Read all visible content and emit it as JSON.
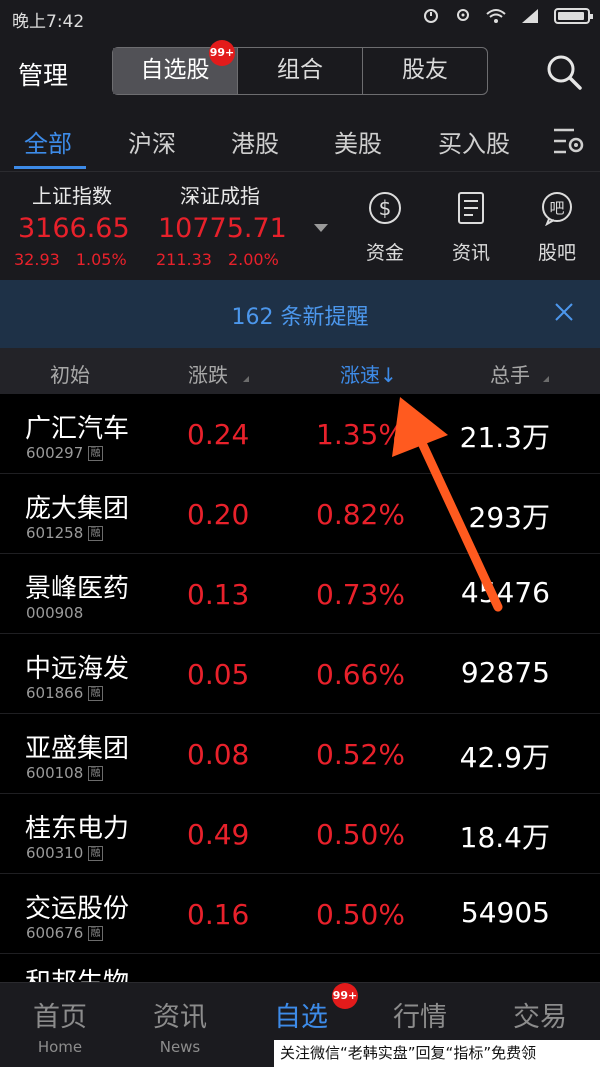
{
  "status": {
    "time": "晚上7:42"
  },
  "header": {
    "manage": "管理",
    "segments": [
      "自选股",
      "组合",
      "股友"
    ],
    "badge": "99+"
  },
  "tabs": [
    "全部",
    "沪深",
    "港股",
    "美股",
    "买入股"
  ],
  "indices": [
    {
      "name": "上证指数",
      "value": "3166.65",
      "change": "32.93",
      "percent": "1.05%"
    },
    {
      "name": "深证成指",
      "value": "10775.71",
      "change": "211.33",
      "percent": "2.00%"
    }
  ],
  "quick_actions": [
    {
      "label": "资金",
      "icon": "dollar-icon"
    },
    {
      "label": "资讯",
      "icon": "news-icon"
    },
    {
      "label": "股吧",
      "icon": "forum-icon"
    }
  ],
  "alert": {
    "text": "162 条新提醒"
  },
  "columns": {
    "c1": "初始",
    "c2": "涨跌",
    "c3": "涨速↓",
    "c4": "总手"
  },
  "stocks": [
    {
      "name": "广汇汽车",
      "code": "600297",
      "tag": "融",
      "change": "0.24",
      "speed": "1.35%",
      "volume": "21.3万"
    },
    {
      "name": "庞大集团",
      "code": "601258",
      "tag": "融",
      "change": "0.20",
      "speed": "0.82%",
      "volume": "293万"
    },
    {
      "name": "景峰医药",
      "code": "000908",
      "tag": "",
      "change": "0.13",
      "speed": "0.73%",
      "volume": "45476"
    },
    {
      "name": "中远海发",
      "code": "601866",
      "tag": "融",
      "change": "0.05",
      "speed": "0.66%",
      "volume": "92875"
    },
    {
      "name": "亚盛集团",
      "code": "600108",
      "tag": "融",
      "change": "0.08",
      "speed": "0.52%",
      "volume": "42.9万"
    },
    {
      "name": "桂东电力",
      "code": "600310",
      "tag": "融",
      "change": "0.49",
      "speed": "0.50%",
      "volume": "18.4万"
    },
    {
      "name": "交运股份",
      "code": "600676",
      "tag": "融",
      "change": "0.16",
      "speed": "0.50%",
      "volume": "54905"
    },
    {
      "name": "和邦生物",
      "code": "",
      "tag": "",
      "change": "",
      "speed": "",
      "volume": ""
    }
  ],
  "nav": [
    {
      "cn": "首页",
      "en": "Home"
    },
    {
      "cn": "资讯",
      "en": "News"
    },
    {
      "cn": "自选",
      "en": ""
    },
    {
      "cn": "行情",
      "en": ""
    },
    {
      "cn": "交易",
      "en": ""
    }
  ],
  "nav_badge": "99+",
  "watermark": "关注微信“老韩实盘”回复“指标”免费领",
  "colors": {
    "up": "#e8212b",
    "accent": "#3d8be8",
    "alert_bg": "#1e3147"
  }
}
